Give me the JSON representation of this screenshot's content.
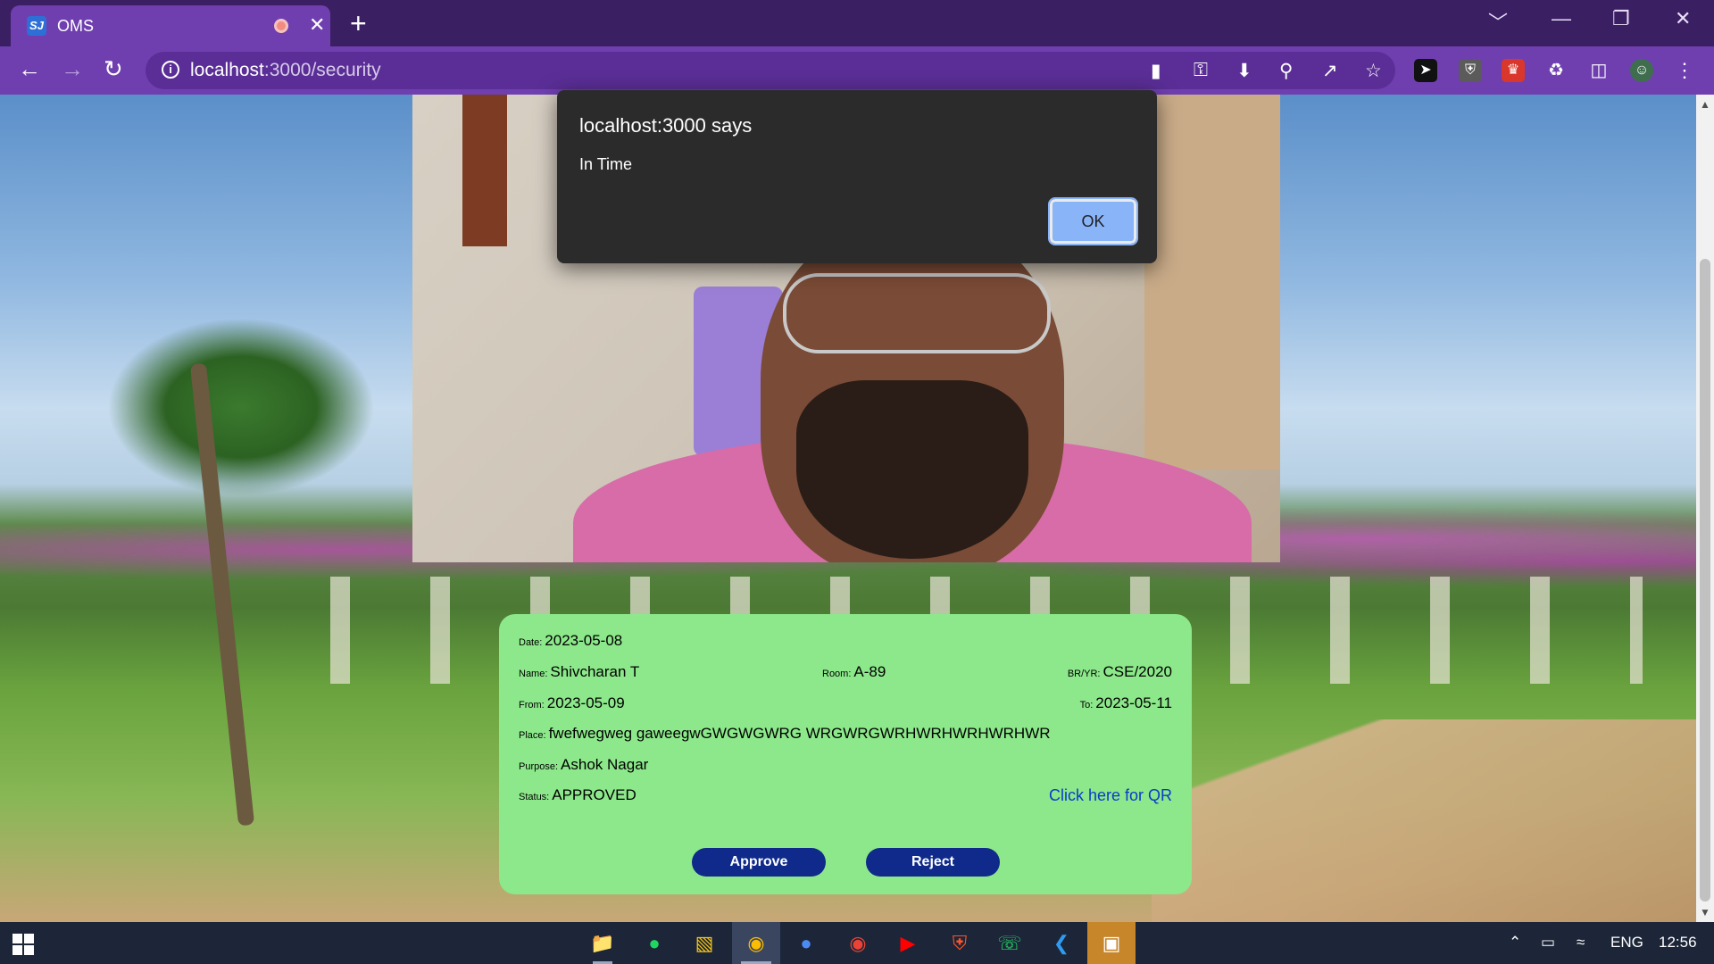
{
  "browser": {
    "tab_title": "OMS",
    "tab_favicon": "SJ",
    "new_tab": "+",
    "tab_close": "✕",
    "url_host": "localhost",
    "url_path": ":3000/security",
    "window_controls": [
      "﹀",
      "—",
      "❐",
      "✕"
    ]
  },
  "dialog": {
    "title": "localhost:3000 says",
    "message": "In Time",
    "ok_label": "OK"
  },
  "card": {
    "date_label": "Date:",
    "date_value": "2023-05-08",
    "name_label": "Name:",
    "name_value": "Shivcharan T",
    "room_label": "Room:",
    "room_value": "A-89",
    "bryr_label": "BR/YR:",
    "bryr_value": "CSE/2020",
    "from_label": "From:",
    "from_value": "2023-05-09",
    "to_label": "To:",
    "to_value": "2023-05-11",
    "place_label": "Place:",
    "place_value": "fwefwegweg gaweegwGWGWGWRG WRGWRGWRHWRHWRHWRHWR",
    "purpose_label": "Purpose:",
    "purpose_value": "Ashok Nagar",
    "status_label": "Status:",
    "status_value": "APPROVED",
    "qr_link": "Click here for QR",
    "approve_label": "Approve",
    "reject_label": "Reject"
  },
  "taskbar": {
    "language": "ENG",
    "time": "12:56",
    "apps": [
      "file-explorer",
      "spotify",
      "app-yellow",
      "chrome",
      "app-blue",
      "chrome-profile",
      "youtube",
      "brave",
      "whatsapp",
      "vscode",
      "app-orange"
    ]
  },
  "colors": {
    "card_bg": "#8ce88a",
    "button_bg": "#0f2a8a",
    "link": "#0a3cc9",
    "browser_accent": "#6f3fb0",
    "dialog_bg": "#2b2b2b",
    "ok_button": "#8ab4f8"
  }
}
